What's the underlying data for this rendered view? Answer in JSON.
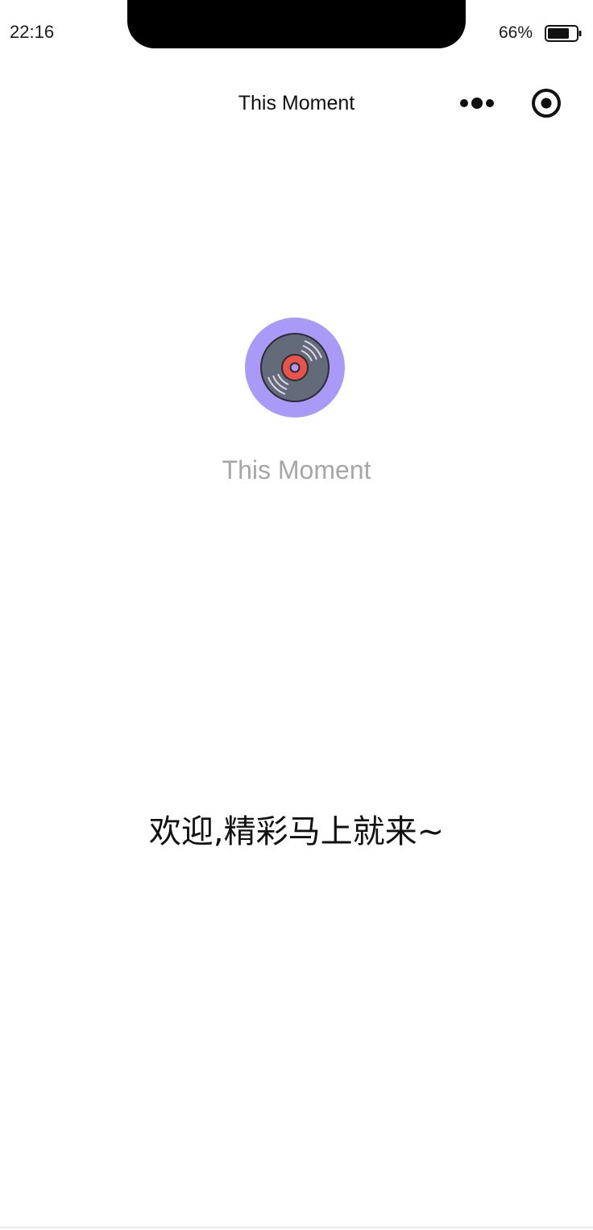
{
  "status_bar": {
    "time": "22:16",
    "battery_percent": "66%",
    "battery_level": 0.66
  },
  "nav_bar": {
    "title": "This Moment",
    "more_icon": "more-dots-icon",
    "close_icon": "target-close-icon"
  },
  "main": {
    "logo_icon": "vinyl-record-icon",
    "app_name": "This Moment",
    "welcome_text": "欢迎,精彩马上就来~"
  },
  "colors": {
    "logo_bg": "#a99af7",
    "record_body": "#636b7a",
    "record_label": "#e8544a",
    "app_name_text": "#a6a6a6"
  }
}
